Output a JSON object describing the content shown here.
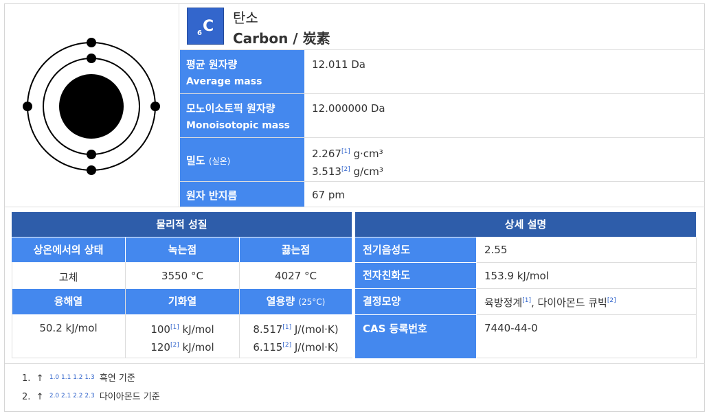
{
  "element": {
    "number": "6",
    "symbol": "C",
    "name_ko": "탄소",
    "name_en": "Carbon / 炭素"
  },
  "properties": {
    "average_mass_label_ko": "평균 원자량",
    "average_mass_label_en": "Average mass",
    "average_mass_value": "12.011 Da",
    "mono_label_ko": "모노이소토픽 원자량",
    "mono_label_en": "Monoisotopic mass",
    "mono_value": "12.000000 Da",
    "density_label": "밀도",
    "density_note": "(실온)",
    "density_value_1": "2.267",
    "density_ref_1": "[1]",
    "density_unit_1": "g·cm³",
    "density_value_2": "3.513",
    "density_ref_2": "[2]",
    "density_unit_2": "g/cm³",
    "radius_label": "원자 반지름",
    "radius_value": "67 pm"
  },
  "physical": {
    "title": "물리적 성질",
    "state_label": "상온에서의 상태",
    "melting_label": "녹는점",
    "boiling_label": "끓는점",
    "state_value": "고체",
    "melting_value": "3550 °C",
    "boiling_value": "4027 °C",
    "fusion_label": "융해열",
    "vapor_label": "기화열",
    "heatcap_label": "열용량",
    "heatcap_note": "(25°C)",
    "fusion_value": "50.2 kJ/mol",
    "vapor_value_1": "100",
    "vapor_ref_1": "[1]",
    "vapor_unit_1": "kJ/mol",
    "vapor_value_2": "120",
    "vapor_ref_2": "[2]",
    "vapor_unit_2": "kJ/mol",
    "heatcap_value_1": "8.517",
    "heatcap_ref_1": "[1]",
    "heatcap_unit_1": "J/(mol·K)",
    "heatcap_value_2": "6.115",
    "heatcap_ref_2": "[2]",
    "heatcap_unit_2": "J/(mol·K)"
  },
  "detail": {
    "title": "상세 설명",
    "electronegativity_label": "전기음성도",
    "electronegativity_value": "2.55",
    "affinity_label": "전자친화도",
    "affinity_value": "153.9 kJ/mol",
    "crystal_label": "결정모양",
    "crystal_value_1": "육방정계",
    "crystal_ref_1": "[1]",
    "crystal_value_2": ", 다이아몬드 큐빅",
    "crystal_ref_2": "[2]",
    "cas_label": "CAS 등록번호",
    "cas_value": "7440-44-0"
  },
  "footnotes": [
    {
      "num": "1.",
      "arrow": "↑",
      "refs": "1.0  1.1  1.2  1.3",
      "text": "흑연 기준"
    },
    {
      "num": "2.",
      "arrow": "↑",
      "refs": "2.0  2.1  2.2  2.3",
      "text": "다이아몬드 기준"
    }
  ],
  "colors": {
    "header_dark": "#2e5daa",
    "header_light": "#4488ee",
    "symbol_box": "#3366cc"
  }
}
